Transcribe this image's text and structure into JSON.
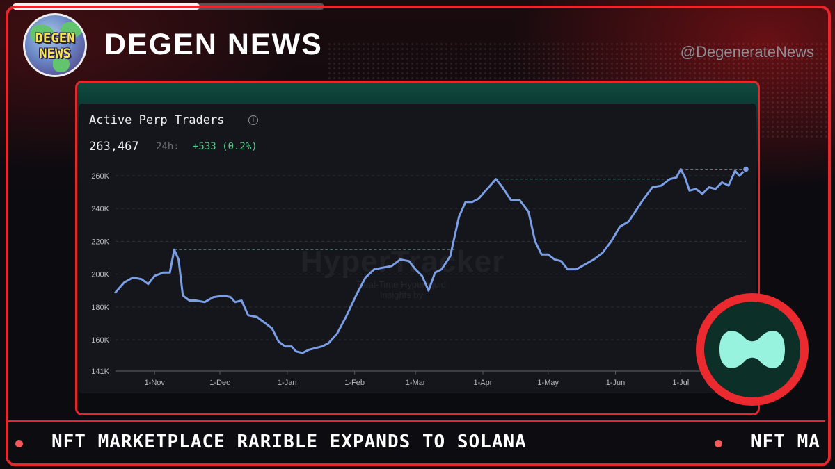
{
  "header": {
    "brand_title": "DEGEN NEWS",
    "handle": "@DegenerateNews",
    "logo_line1": "DEGEN",
    "logo_line2": "NEWS",
    "progress_fraction": 0.6
  },
  "card": {
    "title": "Active Perp Traders",
    "info_icon": "info-icon",
    "value": "263,467",
    "period_label": "24h:",
    "change": "+533 (0.2%)"
  },
  "watermark": {
    "main": "HyperTracker",
    "sub": "Real-Time Hyperliquid Insights by"
  },
  "badge": {
    "icon": "hyperliquid-logo-icon"
  },
  "ticker": {
    "headline": "NFT MARKETPLACE RARIBLE EXPANDS TO SOLANA",
    "headline_repeat": "NFT MA"
  },
  "colors": {
    "accent_red": "#e8262b",
    "line_blue": "#7b9fe6",
    "positive_green": "#54d08a",
    "hyperliquid_mint": "#97f2de"
  },
  "chart_data": {
    "type": "line",
    "title": "Active Perp Traders",
    "xlabel": "",
    "ylabel": "",
    "ylim": [
      141000,
      265000
    ],
    "y_ticks": [
      {
        "label": "260K",
        "value": 260000
      },
      {
        "label": "240K",
        "value": 240000
      },
      {
        "label": "220K",
        "value": 220000
      },
      {
        "label": "200K",
        "value": 200000
      },
      {
        "label": "180K",
        "value": 180000
      },
      {
        "label": "160K",
        "value": 160000
      },
      {
        "label": "141K",
        "value": 141000
      }
    ],
    "x_ticks": [
      {
        "label": "1-Nov",
        "date": "2024-11-01"
      },
      {
        "label": "1-Dec",
        "date": "2024-12-01"
      },
      {
        "label": "1-Jan",
        "date": "2025-01-01"
      },
      {
        "label": "1-Feb",
        "date": "2025-02-01"
      },
      {
        "label": "1-Mar",
        "date": "2025-03-01"
      },
      {
        "label": "1-Apr",
        "date": "2025-04-01"
      },
      {
        "label": "1-May",
        "date": "2025-05-01"
      },
      {
        "label": "1-Jun",
        "date": "2025-06-01"
      },
      {
        "label": "1-Jul",
        "date": "2025-07-01"
      }
    ],
    "x_range": [
      "2024-10-14",
      "2025-07-31"
    ],
    "grid": true,
    "series": [
      {
        "points": [
          [
            "2024-10-14",
            189000
          ],
          [
            "2024-10-18",
            195000
          ],
          [
            "2024-10-22",
            198000
          ],
          [
            "2024-10-26",
            197000
          ],
          [
            "2024-10-29",
            194000
          ],
          [
            "2024-11-01",
            199000
          ],
          [
            "2024-11-05",
            201000
          ],
          [
            "2024-11-08",
            201000
          ],
          [
            "2024-11-10",
            215000
          ],
          [
            "2024-11-12",
            209000
          ],
          [
            "2024-11-14",
            187000
          ],
          [
            "2024-11-17",
            184000
          ],
          [
            "2024-11-20",
            184000
          ],
          [
            "2024-11-24",
            183000
          ],
          [
            "2024-11-28",
            186000
          ],
          [
            "2024-12-03",
            187000
          ],
          [
            "2024-12-06",
            186000
          ],
          [
            "2024-12-08",
            183000
          ],
          [
            "2024-12-11",
            184000
          ],
          [
            "2024-12-14",
            175000
          ],
          [
            "2024-12-18",
            174000
          ],
          [
            "2024-12-22",
            170000
          ],
          [
            "2024-12-25",
            167000
          ],
          [
            "2024-12-28",
            159000
          ],
          [
            "2024-12-31",
            156000
          ],
          [
            "2025-01-03",
            156000
          ],
          [
            "2025-01-05",
            153000
          ],
          [
            "2025-01-08",
            152000
          ],
          [
            "2025-01-11",
            154000
          ],
          [
            "2025-01-14",
            155000
          ],
          [
            "2025-01-17",
            156000
          ],
          [
            "2025-01-20",
            158000
          ],
          [
            "2025-01-24",
            164000
          ],
          [
            "2025-01-28",
            174000
          ],
          [
            "2025-02-02",
            188000
          ],
          [
            "2025-02-06",
            198000
          ],
          [
            "2025-02-10",
            203000
          ],
          [
            "2025-02-14",
            204000
          ],
          [
            "2025-02-18",
            205000
          ],
          [
            "2025-02-22",
            209000
          ],
          [
            "2025-02-26",
            208000
          ],
          [
            "2025-03-01",
            203000
          ],
          [
            "2025-03-04",
            199000
          ],
          [
            "2025-03-07",
            190000
          ],
          [
            "2025-03-10",
            201000
          ],
          [
            "2025-03-13",
            203000
          ],
          [
            "2025-03-17",
            211000
          ],
          [
            "2025-03-21",
            235000
          ],
          [
            "2025-03-24",
            244000
          ],
          [
            "2025-03-27",
            244000
          ],
          [
            "2025-03-30",
            246000
          ],
          [
            "2025-04-03",
            252000
          ],
          [
            "2025-04-07",
            258000
          ],
          [
            "2025-04-10",
            253000
          ],
          [
            "2025-04-14",
            245000
          ],
          [
            "2025-04-18",
            245000
          ],
          [
            "2025-04-22",
            238000
          ],
          [
            "2025-04-25",
            220000
          ],
          [
            "2025-04-28",
            212000
          ],
          [
            "2025-05-01",
            212000
          ],
          [
            "2025-05-04",
            209000
          ],
          [
            "2025-05-07",
            208000
          ],
          [
            "2025-05-10",
            203000
          ],
          [
            "2025-05-14",
            203000
          ],
          [
            "2025-05-18",
            206000
          ],
          [
            "2025-05-22",
            209000
          ],
          [
            "2025-05-26",
            213000
          ],
          [
            "2025-05-30",
            220000
          ],
          [
            "2025-06-03",
            229000
          ],
          [
            "2025-06-07",
            232000
          ],
          [
            "2025-06-10",
            238000
          ],
          [
            "2025-06-14",
            246000
          ],
          [
            "2025-06-18",
            253000
          ],
          [
            "2025-06-22",
            254000
          ],
          [
            "2025-06-26",
            258000
          ],
          [
            "2025-06-29",
            259000
          ],
          [
            "2025-07-01",
            264000
          ],
          [
            "2025-07-03",
            259000
          ],
          [
            "2025-07-05",
            251000
          ],
          [
            "2025-07-08",
            252000
          ],
          [
            "2025-07-11",
            249000
          ],
          [
            "2025-07-14",
            253000
          ],
          [
            "2025-07-17",
            252000
          ],
          [
            "2025-07-20",
            256000
          ],
          [
            "2025-07-23",
            254000
          ],
          [
            "2025-07-26",
            263000
          ],
          [
            "2025-07-28",
            260000
          ],
          [
            "2025-07-31",
            264000
          ]
        ]
      }
    ],
    "reference_lines": [
      {
        "value": 215000,
        "from": "2024-11-10",
        "to": "2025-03-19"
      },
      {
        "value": 258000,
        "from": "2025-04-07",
        "to": "2025-06-27"
      },
      {
        "value": 264000,
        "from": "2025-07-01",
        "to": "2025-07-31"
      }
    ]
  }
}
